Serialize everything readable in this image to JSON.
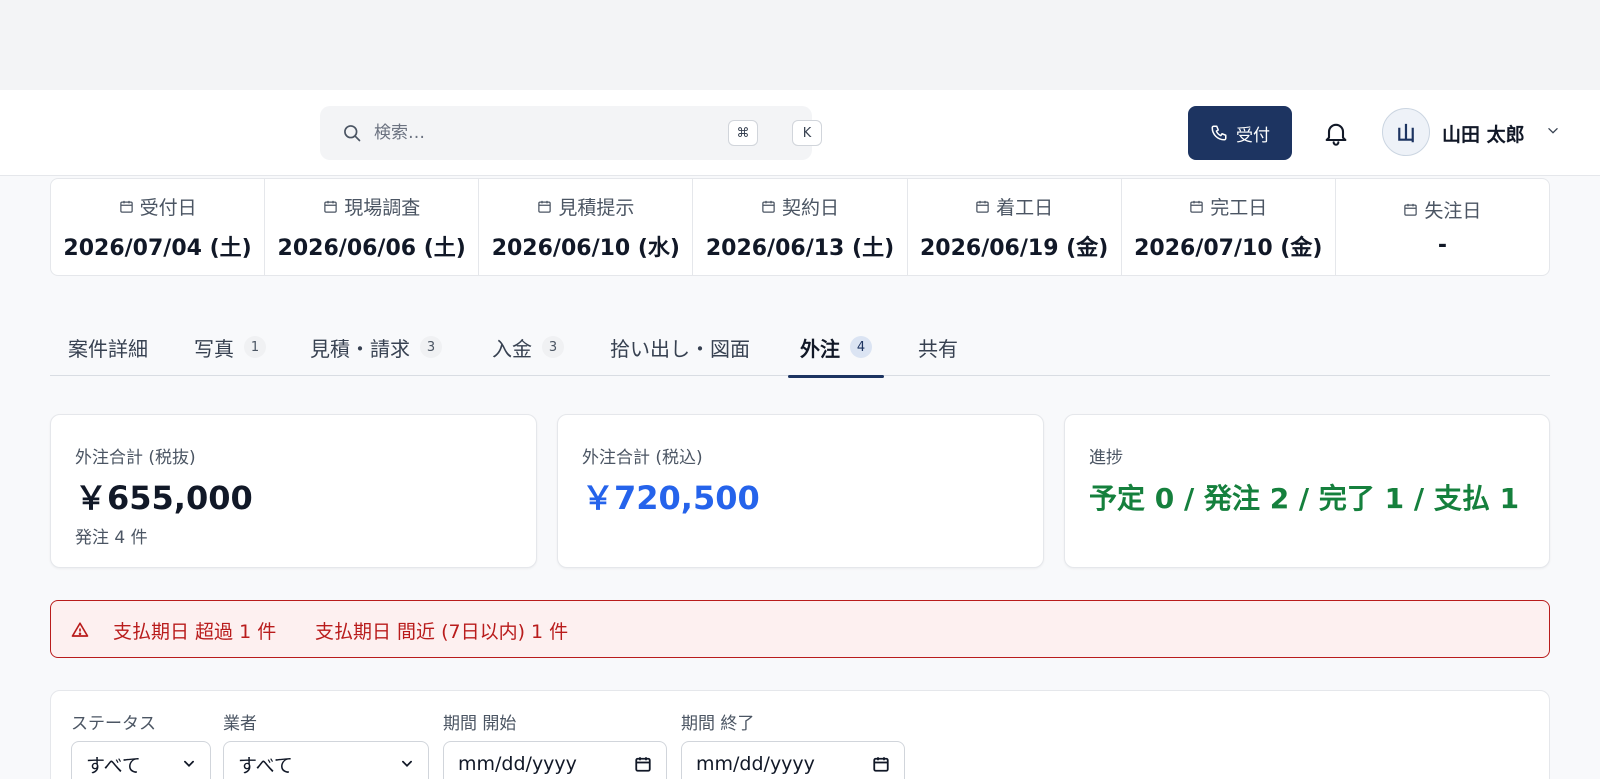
{
  "header": {
    "search_placeholder": "検索…",
    "shortcut_keys": [
      "⌘",
      "K"
    ],
    "reception_label": "受付",
    "user_initial": "山",
    "user_name": "山田 太郎"
  },
  "dates": [
    {
      "label": "受付日",
      "value": "2026/07/04 (土)"
    },
    {
      "label": "現場調査",
      "value": "2026/06/06 (土)"
    },
    {
      "label": "見積提示",
      "value": "2026/06/10 (水)"
    },
    {
      "label": "契約日",
      "value": "2026/06/13 (土)"
    },
    {
      "label": "着工日",
      "value": "2026/06/19 (金)"
    },
    {
      "label": "完工日",
      "value": "2026/07/10 (金)"
    },
    {
      "label": "失注日",
      "value": "-"
    }
  ],
  "tabs": [
    {
      "label": "案件詳細",
      "count": ""
    },
    {
      "label": "写真",
      "count": "1"
    },
    {
      "label": "見積・請求",
      "count": "3"
    },
    {
      "label": "入金",
      "count": "3"
    },
    {
      "label": "拾い出し・図面",
      "count": ""
    },
    {
      "label": "外注",
      "count": "4",
      "active": true
    },
    {
      "label": "共有",
      "count": ""
    }
  ],
  "summary": {
    "total_ex_tax_label": "外注合計 (税抜)",
    "total_ex_tax_value": "￥655,000",
    "order_count": "発注 4 件",
    "total_inc_tax_label": "外注合計 (税込)",
    "total_inc_tax_value": "￥720,500",
    "progress_label": "進捗",
    "progress_value": "予定 0 / 発注 2 / 完了 1 / 支払 1"
  },
  "alert": {
    "overdue": "支払期日 超過 1 件",
    "upcoming": "支払期日 間近 (7日以内) 1 件"
  },
  "filters": {
    "status_label": "ステータス",
    "status_value": "すべて",
    "vendor_label": "業者",
    "vendor_value": "すべて",
    "start_label": "期間 開始",
    "start_value": "mm/dd/yyyy",
    "end_label": "期間 終了",
    "end_value": "mm/dd/yyyy"
  },
  "colors": {
    "primary": "#1d3461",
    "accent_blue": "#2563eb",
    "success_green": "#15803d",
    "alert_red": "#b91c1c"
  }
}
